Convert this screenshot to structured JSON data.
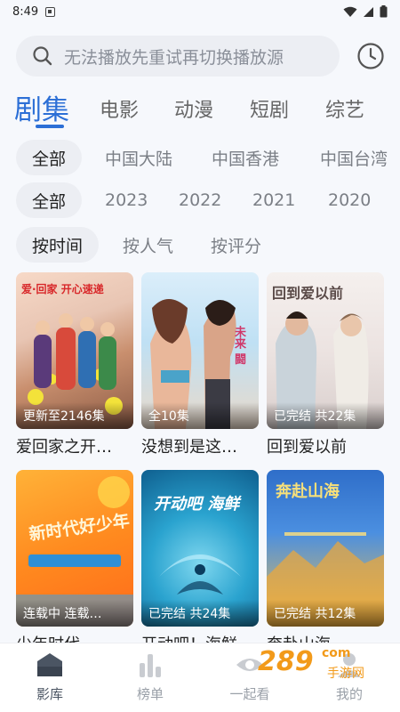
{
  "status": {
    "time": "8:49"
  },
  "search": {
    "placeholder": "无法播放先重试再切换播放源"
  },
  "tabs": [
    "剧集",
    "电影",
    "动漫",
    "短剧",
    "综艺"
  ],
  "region_filters": [
    "全部",
    "中国大陆",
    "中国香港",
    "中国台湾"
  ],
  "year_filters": [
    "全部",
    "2023",
    "2022",
    "2021",
    "2020"
  ],
  "sort_filters": [
    "按时间",
    "按人气",
    "按评分"
  ],
  "shows": [
    {
      "title": "爱回家之开…",
      "badge": "更新至2146集",
      "art": "爱·回家 开心速递"
    },
    {
      "title": "没想到是这…",
      "badge": "全10集",
      "art": "未来 闘"
    },
    {
      "title": "回到爱以前",
      "badge": "已完结 共22集",
      "art": "回到爱以前"
    },
    {
      "title": "少年时代",
      "badge": "连载中 连载…",
      "art": "新时代好少年"
    },
    {
      "title": "开动吧！海鲜",
      "badge": "已完结 共24集",
      "art": "开动吧 海鲜"
    },
    {
      "title": "奔赴山海",
      "badge": "已完结 共12集",
      "art": "奔赴山海"
    }
  ],
  "nav": [
    "影库",
    "榜单",
    "一起看",
    "我的"
  ],
  "watermark": {
    "text": "289",
    "sub": "手游网",
    "suffix": "com"
  },
  "colors": {
    "accent": "#2c6fd6",
    "chip_bg": "#eceef3"
  }
}
